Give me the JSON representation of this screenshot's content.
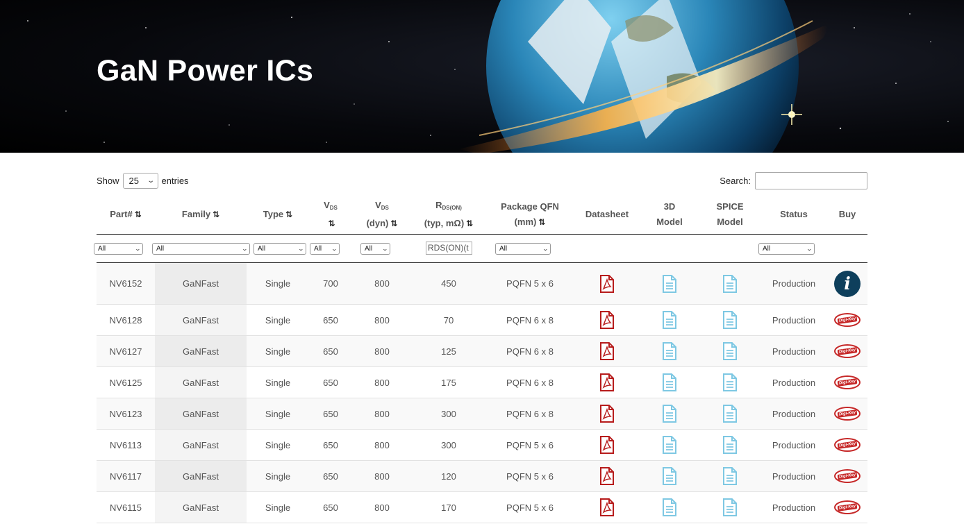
{
  "page": {
    "title": "GaN Power ICs"
  },
  "length": {
    "show_label": "Show",
    "value": "25",
    "entries_label": "entries"
  },
  "search": {
    "label": "Search:",
    "value": ""
  },
  "columns": {
    "part": "Part#",
    "family": "Family",
    "type": "Type",
    "vds_v": "V",
    "vds_sub": "DS",
    "vdsdyn_v": "V",
    "vdsdyn_sub": "DS",
    "vdsdyn_line2": "(dyn)",
    "rds_r": "R",
    "rds_sub": "DS(ON)",
    "rds_line2": "(typ, mΩ)",
    "pkg_line1": "Package QFN",
    "pkg_line2": "(mm)",
    "datasheet": "Datasheet",
    "model3d_line1": "3D",
    "model3d_line2": "Model",
    "spice_line1": "SPICE",
    "spice_line2": "Model",
    "status": "Status",
    "buy": "Buy",
    "sort_glyph": "⇅"
  },
  "filters": {
    "part": "All",
    "family": "All",
    "type": "All",
    "vds": "All",
    "vdsdyn": "All",
    "rds_placeholder": "RDS(ON)(t",
    "pkg": "All",
    "status": "All"
  },
  "rows": [
    {
      "part": "NV6152",
      "family": "GaNFast",
      "type": "Single",
      "vds": "700",
      "vdsdyn": "800",
      "rds": "450",
      "pkg": "PQFN 5 x 6",
      "status": "Production",
      "buy": "info-icon"
    },
    {
      "part": "NV6128",
      "family": "GaNFast",
      "type": "Single",
      "vds": "650",
      "vdsdyn": "800",
      "rds": "70",
      "pkg": "PQFN 6 x 8",
      "status": "Production",
      "buy": "digikey-icon"
    },
    {
      "part": "NV6127",
      "family": "GaNFast",
      "type": "Single",
      "vds": "650",
      "vdsdyn": "800",
      "rds": "125",
      "pkg": "PQFN 6 x 8",
      "status": "Production",
      "buy": "digikey-icon"
    },
    {
      "part": "NV6125",
      "family": "GaNFast",
      "type": "Single",
      "vds": "650",
      "vdsdyn": "800",
      "rds": "175",
      "pkg": "PQFN 6 x 8",
      "status": "Production",
      "buy": "digikey-icon"
    },
    {
      "part": "NV6123",
      "family": "GaNFast",
      "type": "Single",
      "vds": "650",
      "vdsdyn": "800",
      "rds": "300",
      "pkg": "PQFN 6 x 8",
      "status": "Production",
      "buy": "digikey-icon"
    },
    {
      "part": "NV6113",
      "family": "GaNFast",
      "type": "Single",
      "vds": "650",
      "vdsdyn": "800",
      "rds": "300",
      "pkg": "PQFN 5 x 6",
      "status": "Production",
      "buy": "digikey-icon"
    },
    {
      "part": "NV6117",
      "family": "GaNFast",
      "type": "Single",
      "vds": "650",
      "vdsdyn": "800",
      "rds": "120",
      "pkg": "PQFN 5 x 6",
      "status": "Production",
      "buy": "digikey-icon"
    },
    {
      "part": "NV6115",
      "family": "GaNFast",
      "type": "Single",
      "vds": "650",
      "vdsdyn": "800",
      "rds": "170",
      "pkg": "PQFN 5 x 6",
      "status": "Production",
      "buy": "digikey-icon"
    }
  ],
  "icons": {
    "info_glyph": "i",
    "digikey_text": "Digi-Key"
  },
  "colors": {
    "pdf": "#b71c1c",
    "doc": "#7ec8e3",
    "info": "#0e3f5c",
    "digikey": "#c62828"
  }
}
